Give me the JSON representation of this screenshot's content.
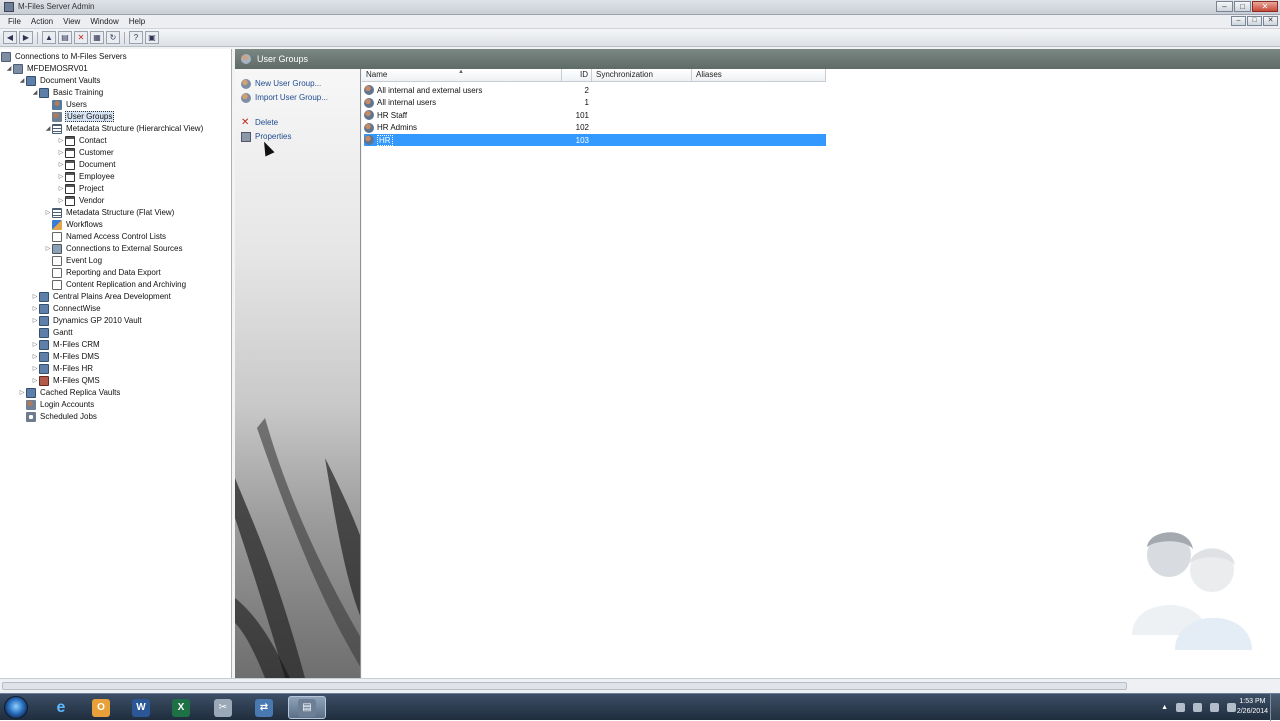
{
  "window": {
    "title": "M-Files Server Admin",
    "controls": [
      "–",
      "□",
      "✕"
    ]
  },
  "menu": [
    "File",
    "Action",
    "View",
    "Window",
    "Help"
  ],
  "toolbar": {
    "icons": [
      "back-icon",
      "forward-icon",
      "up-icon",
      "tree-toggle-icon",
      "delete-icon",
      "properties-icon",
      "refresh-icon",
      "help-icon",
      "console-icon"
    ]
  },
  "tree": [
    {
      "label": "Connections to M-Files Servers",
      "icon": "server"
    },
    {
      "label": "MFDEMOSRV01",
      "icon": "server"
    },
    {
      "label": "Document Vaults",
      "icon": "vault"
    },
    {
      "label": "Basic Training",
      "icon": "vault"
    },
    {
      "label": "Users",
      "icon": "user"
    },
    {
      "label": "User Groups",
      "icon": "group"
    },
    {
      "label": "Metadata Structure (Hierarchical View)",
      "icon": "list"
    },
    {
      "label": "Contact",
      "icon": "obj"
    },
    {
      "label": "Customer",
      "icon": "obj"
    },
    {
      "label": "Document",
      "icon": "obj"
    },
    {
      "label": "Employee",
      "icon": "obj"
    },
    {
      "label": "Project",
      "icon": "obj"
    },
    {
      "label": "Vendor",
      "icon": "obj"
    },
    {
      "label": "Metadata Structure (Flat View)",
      "icon": "list"
    },
    {
      "label": "Workflows",
      "icon": "flow"
    },
    {
      "label": "Named Access Control Lists",
      "icon": "doc"
    },
    {
      "label": "Connections to External Sources",
      "icon": "link"
    },
    {
      "label": "Event Log",
      "icon": "doc"
    },
    {
      "label": "Reporting and Data Export",
      "icon": "doc"
    },
    {
      "label": "Content Replication and Archiving",
      "icon": "doc"
    },
    {
      "label": "Central Plains Area Development",
      "icon": "vault"
    },
    {
      "label": "ConnectWise",
      "icon": "vault"
    },
    {
      "label": "Dynamics GP 2010 Vault",
      "icon": "vault"
    },
    {
      "label": "Gantt",
      "icon": "vault"
    },
    {
      "label": "M-Files CRM",
      "icon": "vault"
    },
    {
      "label": "M-Files DMS",
      "icon": "vault"
    },
    {
      "label": "M-Files HR",
      "icon": "vault"
    },
    {
      "label": "M-Files QMS",
      "icon": "red"
    },
    {
      "label": "Cached Replica Vaults",
      "icon": "vault"
    },
    {
      "label": "Login Accounts",
      "icon": "group"
    },
    {
      "label": "Scheduled Jobs",
      "icon": "gear"
    }
  ],
  "panel": {
    "title": "User Groups"
  },
  "tasks": {
    "new_group": "New User Group...",
    "import_group": "Import User Group...",
    "delete": "Delete",
    "properties": "Properties"
  },
  "list": {
    "columns": {
      "name": "Name",
      "id": "ID",
      "sync": "Synchronization",
      "aliases": "Aliases"
    },
    "rows": [
      {
        "name": "All internal and external users",
        "id": "2"
      },
      {
        "name": "All internal users",
        "id": "1"
      },
      {
        "name": "HR Staff",
        "id": "101"
      },
      {
        "name": "HR Admins",
        "id": "102"
      },
      {
        "name": "HR",
        "id": "103"
      }
    ]
  },
  "taskbar": {
    "apps": [
      "Internet Explorer",
      "Outlook",
      "Word",
      "Excel",
      "Snipping",
      "Network",
      "M-Files Server Admin"
    ]
  },
  "clock": {
    "time": "1:53 PM",
    "date": "2/26/2014"
  },
  "colors": {
    "selection": "#3399ff",
    "header_band": "#6b7773"
  }
}
